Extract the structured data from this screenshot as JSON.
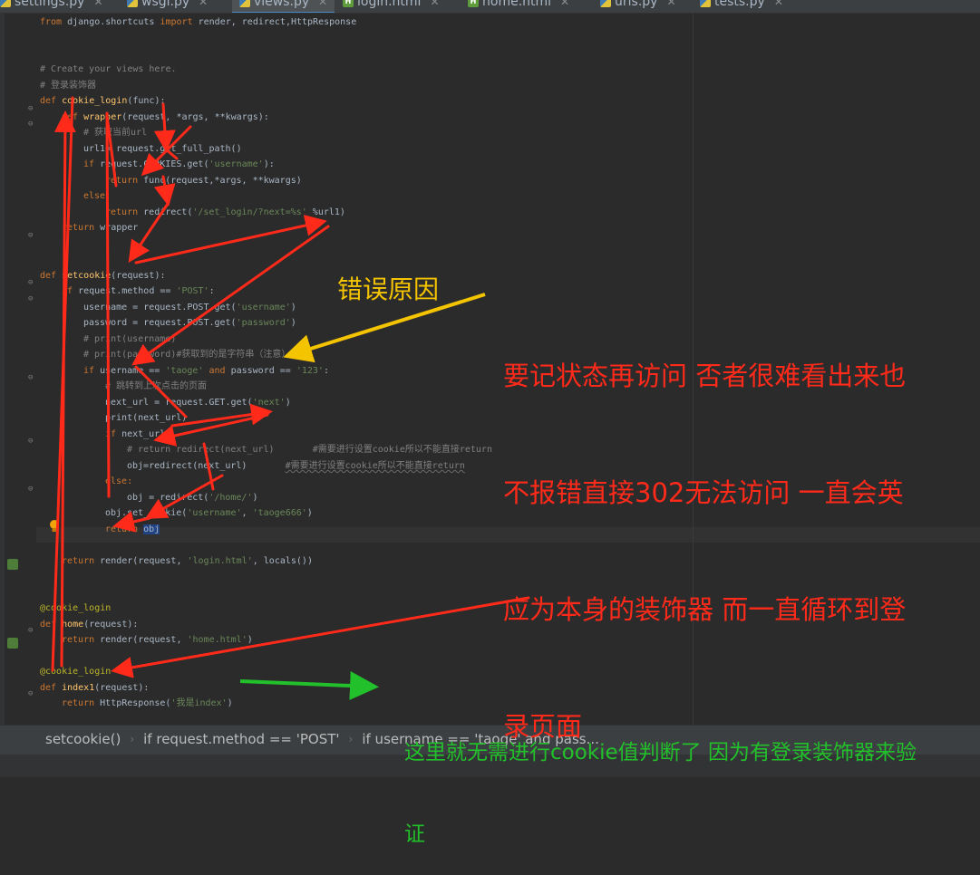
{
  "tabs": [
    {
      "label": "settings.py",
      "type": "py"
    },
    {
      "label": "wsgi.py",
      "type": "py"
    },
    {
      "label": "views.py",
      "type": "py",
      "active": true
    },
    {
      "label": "login.html",
      "type": "html"
    },
    {
      "label": "home.html",
      "type": "html"
    },
    {
      "label": "urls.py",
      "type": "py"
    },
    {
      "label": "tests.py",
      "type": "py"
    }
  ],
  "code": {
    "l1_from": "from",
    "l1_mod": " django.shortcuts ",
    "l1_import": "import",
    "l1_names": " render, redirect,HttpResponse",
    "l4": "# Create your views here.",
    "l5": "# 登录装饰器",
    "l6_def": "def ",
    "l6_name": "cookie_login",
    "l6_rest": "(func):",
    "l7_def": "def ",
    "l7_name": "wrapper",
    "l7_rest": "(request, *args, **kwargs):",
    "l8": "# 获取当前url",
    "l9": "url1= request.get_full_path()",
    "l10_if": "if ",
    "l10_a": "request.COOKIES.get(",
    "l10_s": "'username'",
    "l10_b": "):",
    "l11_ret": "return ",
    "l11_rest": "func(request,*args, **kwargs)",
    "l12": "else:",
    "l13_ret": "return ",
    "l13_a": "redirect(",
    "l13_s": "'/set_login/?next=%s'",
    "l13_b": " %url1)",
    "l14_ret": "return ",
    "l14_rest": "wrapper",
    "l17_def": "def ",
    "l17_name": "setcookie",
    "l17_rest": "(request):",
    "l18_if": "if ",
    "l18_a": "request.method == ",
    "l18_s": "'POST'",
    "l18_b": ":",
    "l19_a": "username = request.POST.get(",
    "l19_s": "'username'",
    "l19_b": ")",
    "l20_a": "password = request.POST.get(",
    "l20_s": "'password'",
    "l20_b": ")",
    "l21": "# print(username)",
    "l22": "# print(password)#获取到的是字符串（注意）",
    "l23_if": "if ",
    "l23_a": "username == ",
    "l23_s1": "'taoge'",
    "l23_and": " and ",
    "l23_b": "password == ",
    "l23_s2": "'123'",
    "l23_c": ":",
    "l24": "# 跳转到上次点击的页面",
    "l25_a": "next_url = request.GET.get(",
    "l25_s": "'next'",
    "l25_b": ")",
    "l26": "print(next_url)",
    "l27_if": "if ",
    "l27_rest": "next_url:",
    "l28": "# return redirect(next_url)       #需要进行设置cookie所以不能直接return",
    "l29_code": "obj=redirect(next_url)       ",
    "l29_cm": "#需要进行设置cookie所以不能直接return",
    "l30": "else:",
    "l31_a": "obj = redirect(",
    "l31_s": "'/home/'",
    "l31_b": ")",
    "l32_a": "obj.set_cookie(",
    "l32_s1": "'username'",
    "l32_b": ", ",
    "l32_s2": "'taoge666'",
    "l32_c": ")",
    "l33_ret": "return ",
    "l33_rest": "obj",
    "l35_ret": "return ",
    "l35_a": "render(request, ",
    "l35_s": "'login.html'",
    "l35_b": ", locals())",
    "l38": "@cookie_login",
    "l39_def": "def ",
    "l39_name": "home",
    "l39_rest": "(request):",
    "l40_ret": "return ",
    "l40_a": "render(request, ",
    "l40_s": "'home.html'",
    "l40_b": ")",
    "l42": "@cookie_login",
    "l43_def": "def ",
    "l43_name": "index1",
    "l43_rest": "(request):",
    "l44_ret": "return ",
    "l44_a": "HttpResponse(",
    "l44_s": "'我是index'",
    "l44_b": ")"
  },
  "breadcrumbs": [
    "setcookie()",
    "if request.method == 'POST'",
    "if username == 'taoge' and pass..."
  ],
  "annotations": {
    "error_reason": "错误原因",
    "red_note_lines": [
      "要记状态再访问 否者很难看出来也",
      "不报错直接302无法访问 一直会英",
      "应为本身的装饰器 而一直循环到登",
      "录页面"
    ],
    "green_note_lines": [
      "这里就无需进行cookie值判断了 因为有登录装饰器来验",
      "证"
    ]
  },
  "colors": {
    "background": "#2b2b2b",
    "keyword": "#cc7832",
    "function": "#ffc66d",
    "string": "#6a8759",
    "comment": "#808080",
    "decorator": "#bbb529",
    "annotation_red": "#ff2a1a",
    "annotation_yellow": "#f5c400",
    "annotation_green": "#22c02a"
  }
}
